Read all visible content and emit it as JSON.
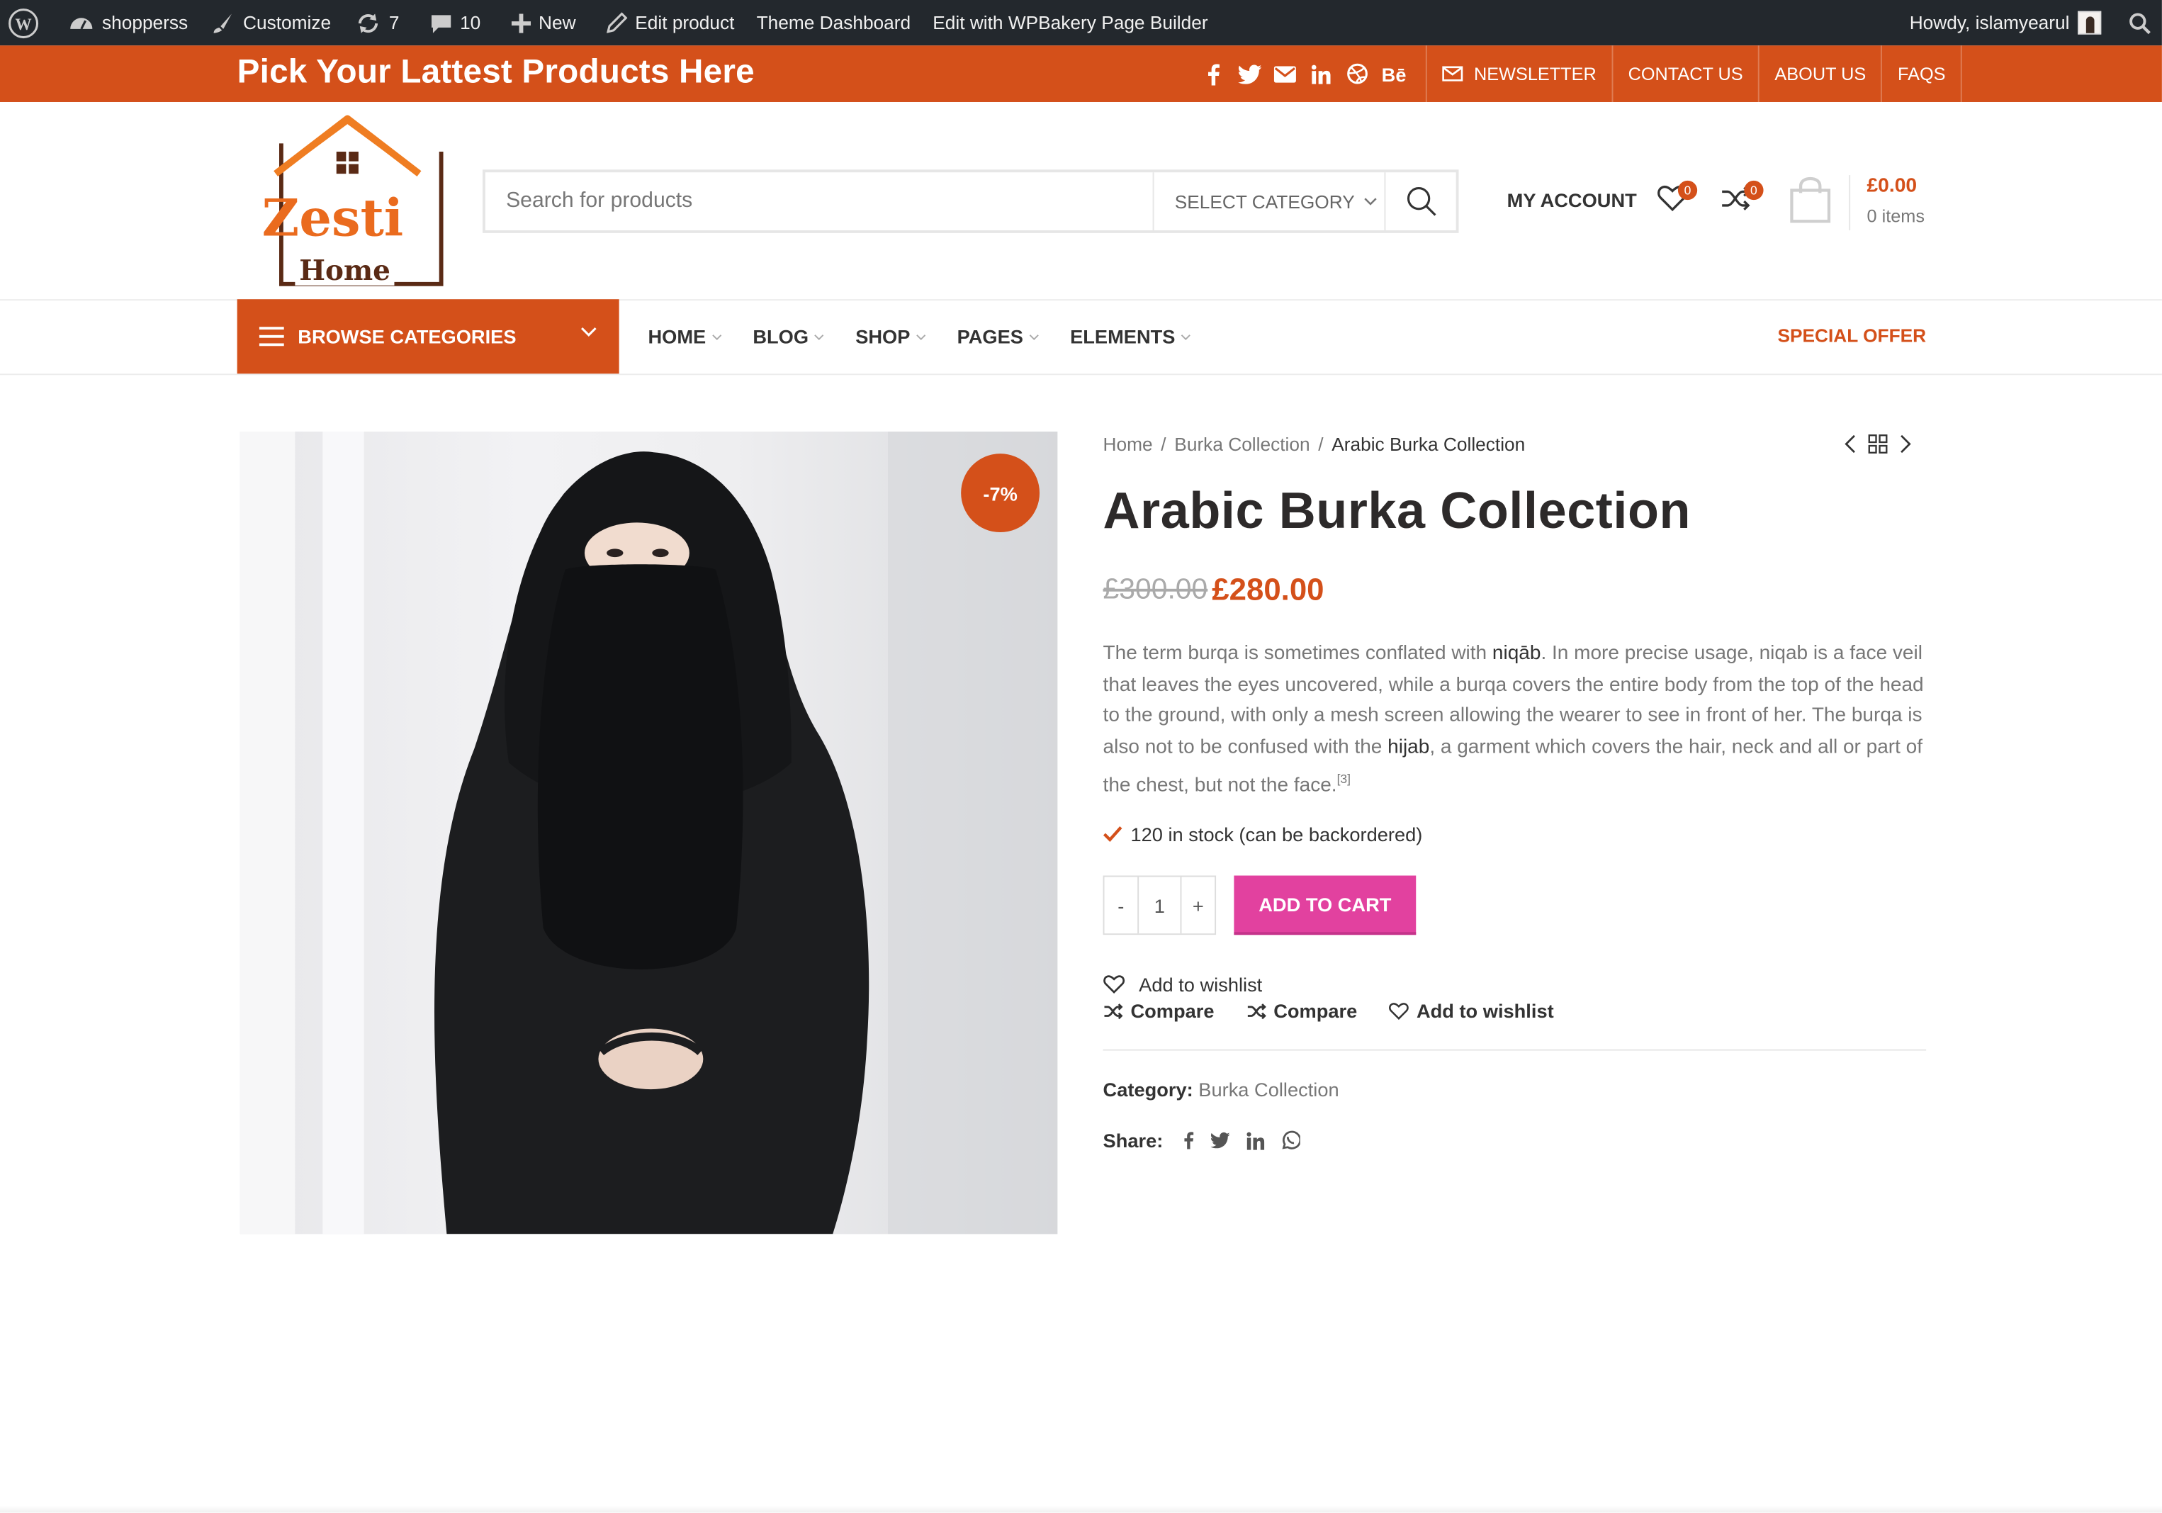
{
  "adminbar": {
    "site_name": "shopperss",
    "customize": "Customize",
    "updates_count": "7",
    "comments_count": "10",
    "new_label": "New",
    "edit_product": "Edit product",
    "theme_dashboard": "Theme Dashboard",
    "wpbakery": "Edit with WPBakery Page Builder",
    "howdy": "Howdy, islamyearul"
  },
  "topbar": {
    "tagline": "Pick Your Lattest Products Here",
    "social_icons": [
      "facebook-icon",
      "twitter-icon",
      "email-icon",
      "linkedin-icon",
      "dribbble-icon",
      "behance-icon"
    ],
    "behance_label": "Bē",
    "links": {
      "newsletter": "NEWSLETTER",
      "contact": "CONTACT US",
      "about": "ABOUT US",
      "faqs": "FAQS"
    }
  },
  "header": {
    "logo_text": "Zesti",
    "logo_subtext": "Home",
    "search_placeholder": "Search for products",
    "select_category": "SELECT CATEGORY",
    "my_account": "MY ACCOUNT",
    "wishlist_count": "0",
    "compare_count": "0",
    "cart_total": "£0.00",
    "cart_items": "0 items"
  },
  "nav": {
    "browse": "BROWSE CATEGORIES",
    "items": [
      "HOME",
      "BLOG",
      "SHOP",
      "PAGES",
      "ELEMENTS"
    ],
    "special_offer": "SPECIAL OFFER"
  },
  "product": {
    "discount": "-7%",
    "breadcrumb": [
      "Home",
      "Burka Collection",
      "Arabic Burka Collection"
    ],
    "title": "Arabic Burka Collection",
    "price_old": "£300.00",
    "price_new": "£280.00",
    "desc_1": "The term burqa is sometimes conflated with ",
    "desc_link1": "niqāb",
    "desc_2": ". In more precise usage, niqab is a face veil that leaves the eyes uncovered, while a burqa covers the entire body from the top of the head to the ground, with only a mesh screen allowing the wearer to see in front of her. The burqa is also not to be confused with the ",
    "desc_link2": "hijab",
    "desc_3": ", a garment which covers the hair, neck and all or part of the chest, but not the face.",
    "desc_ref": "[3]",
    "stock": "120 in stock (can be backordered)",
    "qty": "1",
    "qty_minus": "-",
    "qty_plus": "+",
    "add_to_cart": "ADD TO CART",
    "add_to_wishlist": "Add to wishlist",
    "compare": "Compare",
    "category_label": "Category:",
    "category_value": "Burka Collection",
    "share_label": "Share:"
  },
  "colors": {
    "accent": "#d4501a",
    "cart_button": "#e2419f",
    "adminbar": "#23282d"
  }
}
